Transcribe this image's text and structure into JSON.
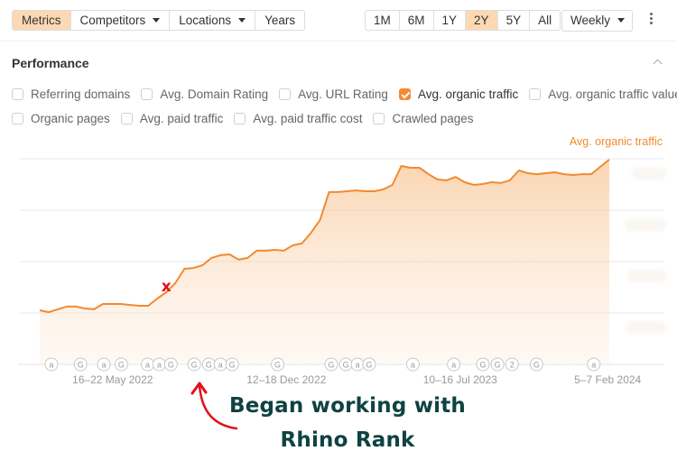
{
  "toolbar": {
    "left_buttons": [
      {
        "label": "Metrics",
        "active": true,
        "dropdown": false
      },
      {
        "label": "Competitors",
        "active": false,
        "dropdown": true
      },
      {
        "label": "Locations",
        "active": false,
        "dropdown": true
      },
      {
        "label": "Years",
        "active": false,
        "dropdown": false
      }
    ],
    "ranges": [
      {
        "label": "1M",
        "active": false
      },
      {
        "label": "6M",
        "active": false
      },
      {
        "label": "1Y",
        "active": false
      },
      {
        "label": "2Y",
        "active": true
      },
      {
        "label": "5Y",
        "active": false
      },
      {
        "label": "All",
        "active": false
      }
    ],
    "interval": "Weekly",
    "more_icon": "kebab-icon"
  },
  "section": {
    "title": "Performance",
    "collapse_icon": "chevron-up-icon"
  },
  "metrics": {
    "row1": [
      {
        "label": "Referring domains",
        "checked": false
      },
      {
        "label": "Avg. Domain Rating",
        "checked": false
      },
      {
        "label": "Avg. URL Rating",
        "checked": false
      },
      {
        "label": "Avg. organic traffic",
        "checked": true
      },
      {
        "label": "Avg. organic traffic value",
        "checked": false
      }
    ],
    "row2": [
      {
        "label": "Organic pages",
        "checked": false
      },
      {
        "label": "Avg. paid traffic",
        "checked": false
      },
      {
        "label": "Avg. paid traffic cost",
        "checked": false
      },
      {
        "label": "Crawled pages",
        "checked": false
      }
    ]
  },
  "colors": {
    "accent": "#f28a30",
    "active_button": "#fcd9b3",
    "marker": "#e0101a",
    "callout_text": "#0f4242"
  },
  "annotation": {
    "marker": "x",
    "callout_line1": "Began working with",
    "callout_line2": "Rhino Rank"
  },
  "chart_data": {
    "type": "area",
    "title": "",
    "series": [
      {
        "name": "Avg. organic traffic",
        "values_note": "y-axis values are blurred in the screenshot; values are relative (1.0 = top gridline, 0 = axis baseline)",
        "values": [
          0.263,
          0.254,
          0.268,
          0.281,
          0.281,
          0.272,
          0.268,
          0.294,
          0.294,
          0.294,
          0.289,
          0.285,
          0.285,
          0.32,
          0.351,
          0.395,
          0.465,
          0.469,
          0.482,
          0.518,
          0.531,
          0.535,
          0.509,
          0.518,
          0.553,
          0.553,
          0.557,
          0.553,
          0.579,
          0.588,
          0.64,
          0.702,
          0.838,
          0.838,
          0.842,
          0.846,
          0.842,
          0.842,
          0.851,
          0.873,
          0.965,
          0.956,
          0.956,
          0.925,
          0.899,
          0.895,
          0.912,
          0.886,
          0.873,
          0.877,
          0.886,
          0.882,
          0.895,
          0.943,
          0.93,
          0.925,
          0.93,
          0.934,
          0.925,
          0.921,
          0.925,
          0.925,
          0.961,
          0.996
        ]
      }
    ],
    "x_tick_labels": [
      "16–22 May 2022",
      "12–18 Dec 2022",
      "10–16 Jul 2023",
      "5–7 Feb 2024"
    ],
    "x_tick_positions": [
      0.125,
      0.423,
      0.721,
      0.974
    ],
    "y_gridlines": 4,
    "y_tick_labels_hidden": true,
    "ylim": [
      0,
      1
    ],
    "legend": "top-right",
    "legend_label": "Avg. organic traffic",
    "marker_index": 15,
    "event_annotations": [
      {
        "pos": 0.02,
        "label": "a"
      },
      {
        "pos": 0.07,
        "label": "G"
      },
      {
        "pos": 0.11,
        "label": "a"
      },
      {
        "pos": 0.14,
        "label": "G"
      },
      {
        "pos": 0.185,
        "label": "a"
      },
      {
        "pos": 0.205,
        "label": "a"
      },
      {
        "pos": 0.225,
        "label": "G"
      },
      {
        "pos": 0.265,
        "label": "G"
      },
      {
        "pos": 0.29,
        "label": "G"
      },
      {
        "pos": 0.31,
        "label": "a"
      },
      {
        "pos": 0.33,
        "label": "G"
      },
      {
        "pos": 0.408,
        "label": "G"
      },
      {
        "pos": 0.5,
        "label": "G"
      },
      {
        "pos": 0.525,
        "label": "G"
      },
      {
        "pos": 0.545,
        "label": "a"
      },
      {
        "pos": 0.565,
        "label": "G"
      },
      {
        "pos": 0.64,
        "label": "a"
      },
      {
        "pos": 0.71,
        "label": "a"
      },
      {
        "pos": 0.76,
        "label": "G"
      },
      {
        "pos": 0.785,
        "label": "G"
      },
      {
        "pos": 0.81,
        "label": "2"
      },
      {
        "pos": 0.852,
        "label": "G"
      },
      {
        "pos": 0.95,
        "label": "a"
      }
    ]
  }
}
